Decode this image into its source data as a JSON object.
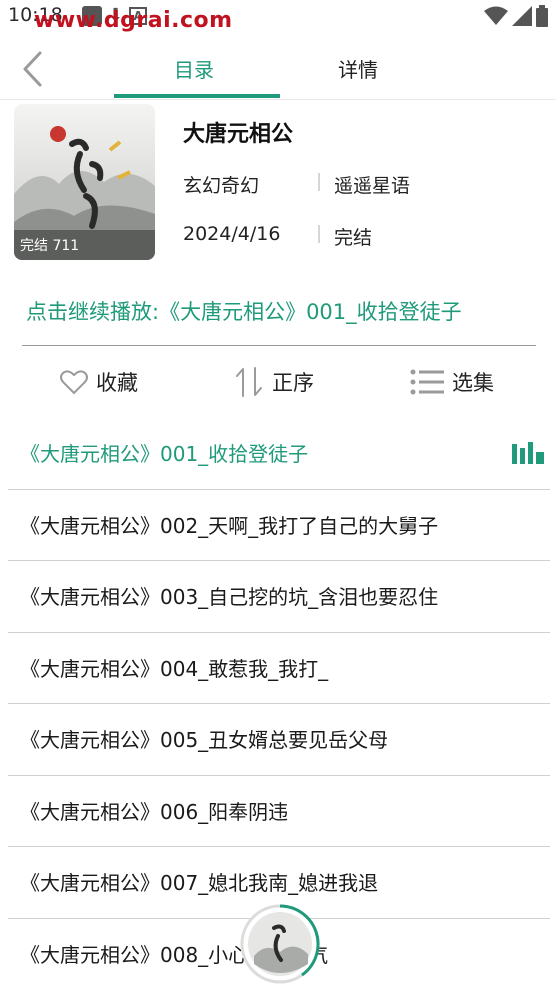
{
  "status_bar": {
    "time": "10:18",
    "watermark": "www.dgrai.com"
  },
  "tabs": [
    {
      "label": "目录",
      "active": true
    },
    {
      "label": "详情",
      "active": false
    }
  ],
  "book": {
    "title": "大唐元相公",
    "genre": "玄幻奇幻",
    "author": "遥遥星语",
    "date": "2024/4/16",
    "status": "完结",
    "cover_badge": "完结 711"
  },
  "continue_text": "点击继续播放:《大唐元相公》001_收拾登徒子",
  "actions": {
    "favorite": "收藏",
    "order": "正序",
    "select": "选集"
  },
  "episodes": [
    "《大唐元相公》001_收拾登徒子",
    "《大唐元相公》002_天啊_我打了自己的大舅子",
    "《大唐元相公》003_自己挖的坑_含泪也要忍住",
    "《大唐元相公》004_敢惹我_我打_",
    "《大唐元相公》005_丑女婿总要见岳父母",
    "《大唐元相公》006_阳奉阴违",
    "《大唐元相公》007_媳北我南_媳进我退",
    "《大唐元相公》008_小心惹我生气"
  ],
  "colors": {
    "accent": "#1f9a7a",
    "text": "#1a1a1a",
    "divider": "#d0d0d0"
  }
}
